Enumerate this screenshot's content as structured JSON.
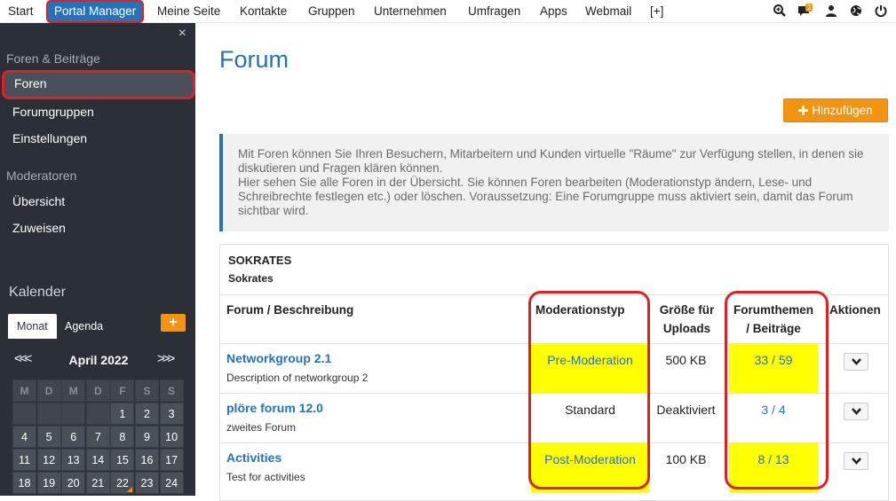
{
  "topnav": {
    "items": [
      {
        "label": "Start"
      },
      {
        "label": "Portal Manager"
      },
      {
        "label": "Meine Seite"
      },
      {
        "label": "Kontakte"
      },
      {
        "label": "Gruppen"
      },
      {
        "label": "Unternehmen"
      },
      {
        "label": "Umfragen"
      },
      {
        "label": "Apps"
      },
      {
        "label": "Webmail"
      },
      {
        "label": "[+]"
      }
    ],
    "notification_count": "2",
    "icons": [
      "search-zoom-icon",
      "chat-icon",
      "user-icon",
      "globe-icon",
      "power-icon"
    ]
  },
  "sidebar": {
    "close_glyph": "×",
    "section_forums": "Foren & Beiträge",
    "forum_items": [
      {
        "label": "Foren"
      },
      {
        "label": "Forumgruppen"
      },
      {
        "label": "Einstellungen"
      }
    ],
    "section_moderators": "Moderatoren",
    "moderator_items": [
      {
        "label": "Übersicht"
      },
      {
        "label": "Zuweisen"
      }
    ],
    "calendar": {
      "title": "Kalender",
      "tabs": [
        {
          "label": "Monat"
        },
        {
          "label": "Agenda"
        }
      ],
      "add_glyph": "+",
      "prev_glyph": "<<<",
      "next_glyph": ">>>",
      "month_label": "April 2022",
      "weekdays": [
        "M",
        "D",
        "M",
        "D",
        "F",
        "S",
        "S"
      ],
      "weeks": [
        [
          "",
          "",
          "",
          "",
          "1",
          "2",
          "3"
        ],
        [
          "4",
          "5",
          "6",
          "7",
          "8",
          "9",
          "10"
        ],
        [
          "11",
          "12",
          "13",
          "14",
          "15",
          "16",
          "17"
        ],
        [
          "18",
          "19",
          "20",
          "21",
          "22",
          "23",
          "24"
        ]
      ],
      "marked_day": "22"
    }
  },
  "main": {
    "title": "Forum",
    "add_button": "Hinzufügen",
    "info_text_1": "Mit Foren können Sie Ihren Besuchern, Mitarbeitern und Kunden virtuelle \"Räume\" zur Verfügung stellen, in denen sie diskutieren und Fragen klären können.",
    "info_text_2": "Hier sehen Sie alle Foren in der Übersicht. Sie können Foren bearbeiten (Moderationstyp ändern, Lese- und Schreibrechte festlegen etc.) oder löschen. Voraussetzung: Eine Forumgruppe muss aktiviert sein, damit das Forum sichtbar wird.",
    "group_title": "SOKRATES",
    "group_subtitle": "Sokrates",
    "columns": {
      "forum": "Forum / Beschreibung",
      "modtype": "Moderationstyp",
      "upload_1": "Größe für",
      "upload_2": "Uploads",
      "topics_1": "Forumthemen",
      "topics_2": "/ Beiträge",
      "actions": "Aktionen"
    },
    "rows": [
      {
        "name": "Networkgroup 2.1",
        "desc": "Description of networkgroup 2",
        "modtype": "Pre-Moderation",
        "upload": "500 KB",
        "counts": "33 / 59"
      },
      {
        "name": "plöre forum 12.0",
        "desc": "zweites Forum",
        "modtype": "Standard",
        "upload": "Deaktiviert",
        "counts": "3 / 4"
      },
      {
        "name": "Activities",
        "desc": "Test for activities",
        "modtype": "Post-Moderation",
        "upload": "100 KB",
        "counts": "8 / 13"
      }
    ]
  },
  "colors": {
    "accent": "#2472b8",
    "orange": "#f39410",
    "sidebar": "#2a2f38",
    "highlight": "#ffff00",
    "annotation": "#e02020"
  }
}
